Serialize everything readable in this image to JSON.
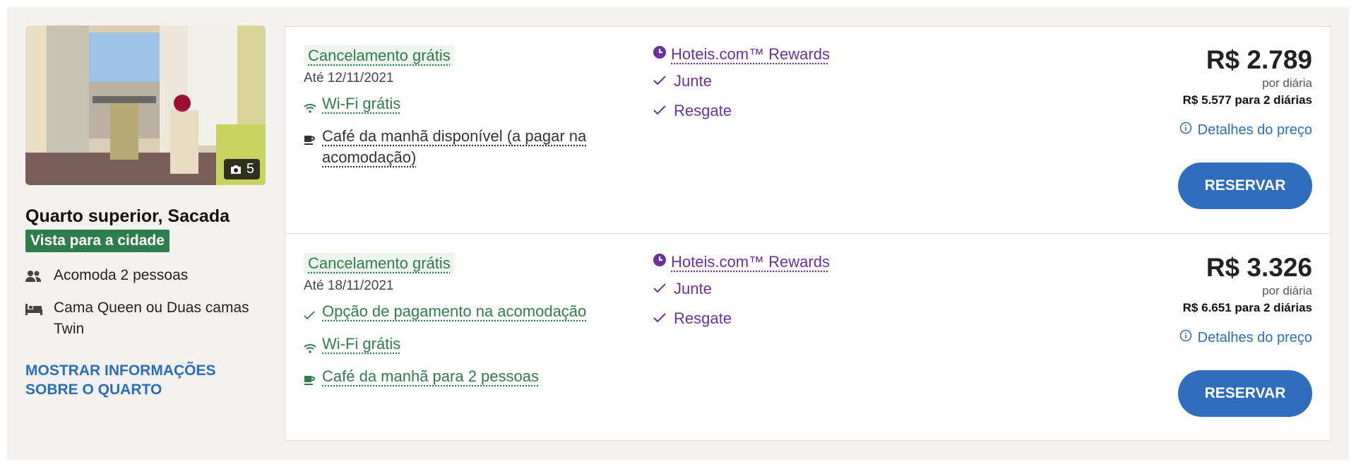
{
  "room": {
    "photo_count": "5",
    "title": "Quarto superior, Sacada",
    "view_badge": "Vista para a cidade",
    "features": [
      {
        "icon": "people-icon",
        "text": "Acomoda 2 pessoas"
      },
      {
        "icon": "bed-icon",
        "text": "Cama Queen ou Duas camas Twin"
      }
    ],
    "more_link": "MOSTRAR INFORMAÇÕES SOBRE O QUARTO"
  },
  "offers": [
    {
      "cancel": "Cancelamento grátis",
      "until": "Até 12/11/2021",
      "amenities": [
        {
          "icon": "wifi-icon",
          "text": "Wi-Fi grátis",
          "style": "green"
        },
        {
          "icon": "coffee-icon",
          "text": "Café da manhã disponível (a pagar na acomodação)",
          "style": "gray"
        }
      ],
      "rewards": "Hoteis.com™ Rewards",
      "reward_items": [
        "Junte",
        "Resgate"
      ],
      "price": "R$ 2.789",
      "per_night": "por diária",
      "total": "R$ 5.577 para 2 diárias",
      "details": "Detalhes do preço",
      "button": "RESERVAR"
    },
    {
      "cancel": "Cancelamento grátis",
      "until": "Até 18/11/2021",
      "amenities": [
        {
          "icon": "check-icon",
          "text": "Opção de pagamento na acomodação",
          "style": "green"
        },
        {
          "icon": "wifi-icon",
          "text": "Wi-Fi grátis",
          "style": "green"
        },
        {
          "icon": "coffee-icon",
          "text": "Café da manhã para 2 pessoas",
          "style": "green"
        }
      ],
      "rewards": "Hoteis.com™ Rewards",
      "reward_items": [
        "Junte",
        "Resgate"
      ],
      "price": "R$ 3.326",
      "per_night": "por diária",
      "total": "R$ 6.651 para 2 diárias",
      "details": "Detalhes do preço",
      "button": "RESERVAR"
    }
  ],
  "colors": {
    "green": "#2e7d4a",
    "purple": "#6b2fa0",
    "blue": "#2f6ebd"
  }
}
